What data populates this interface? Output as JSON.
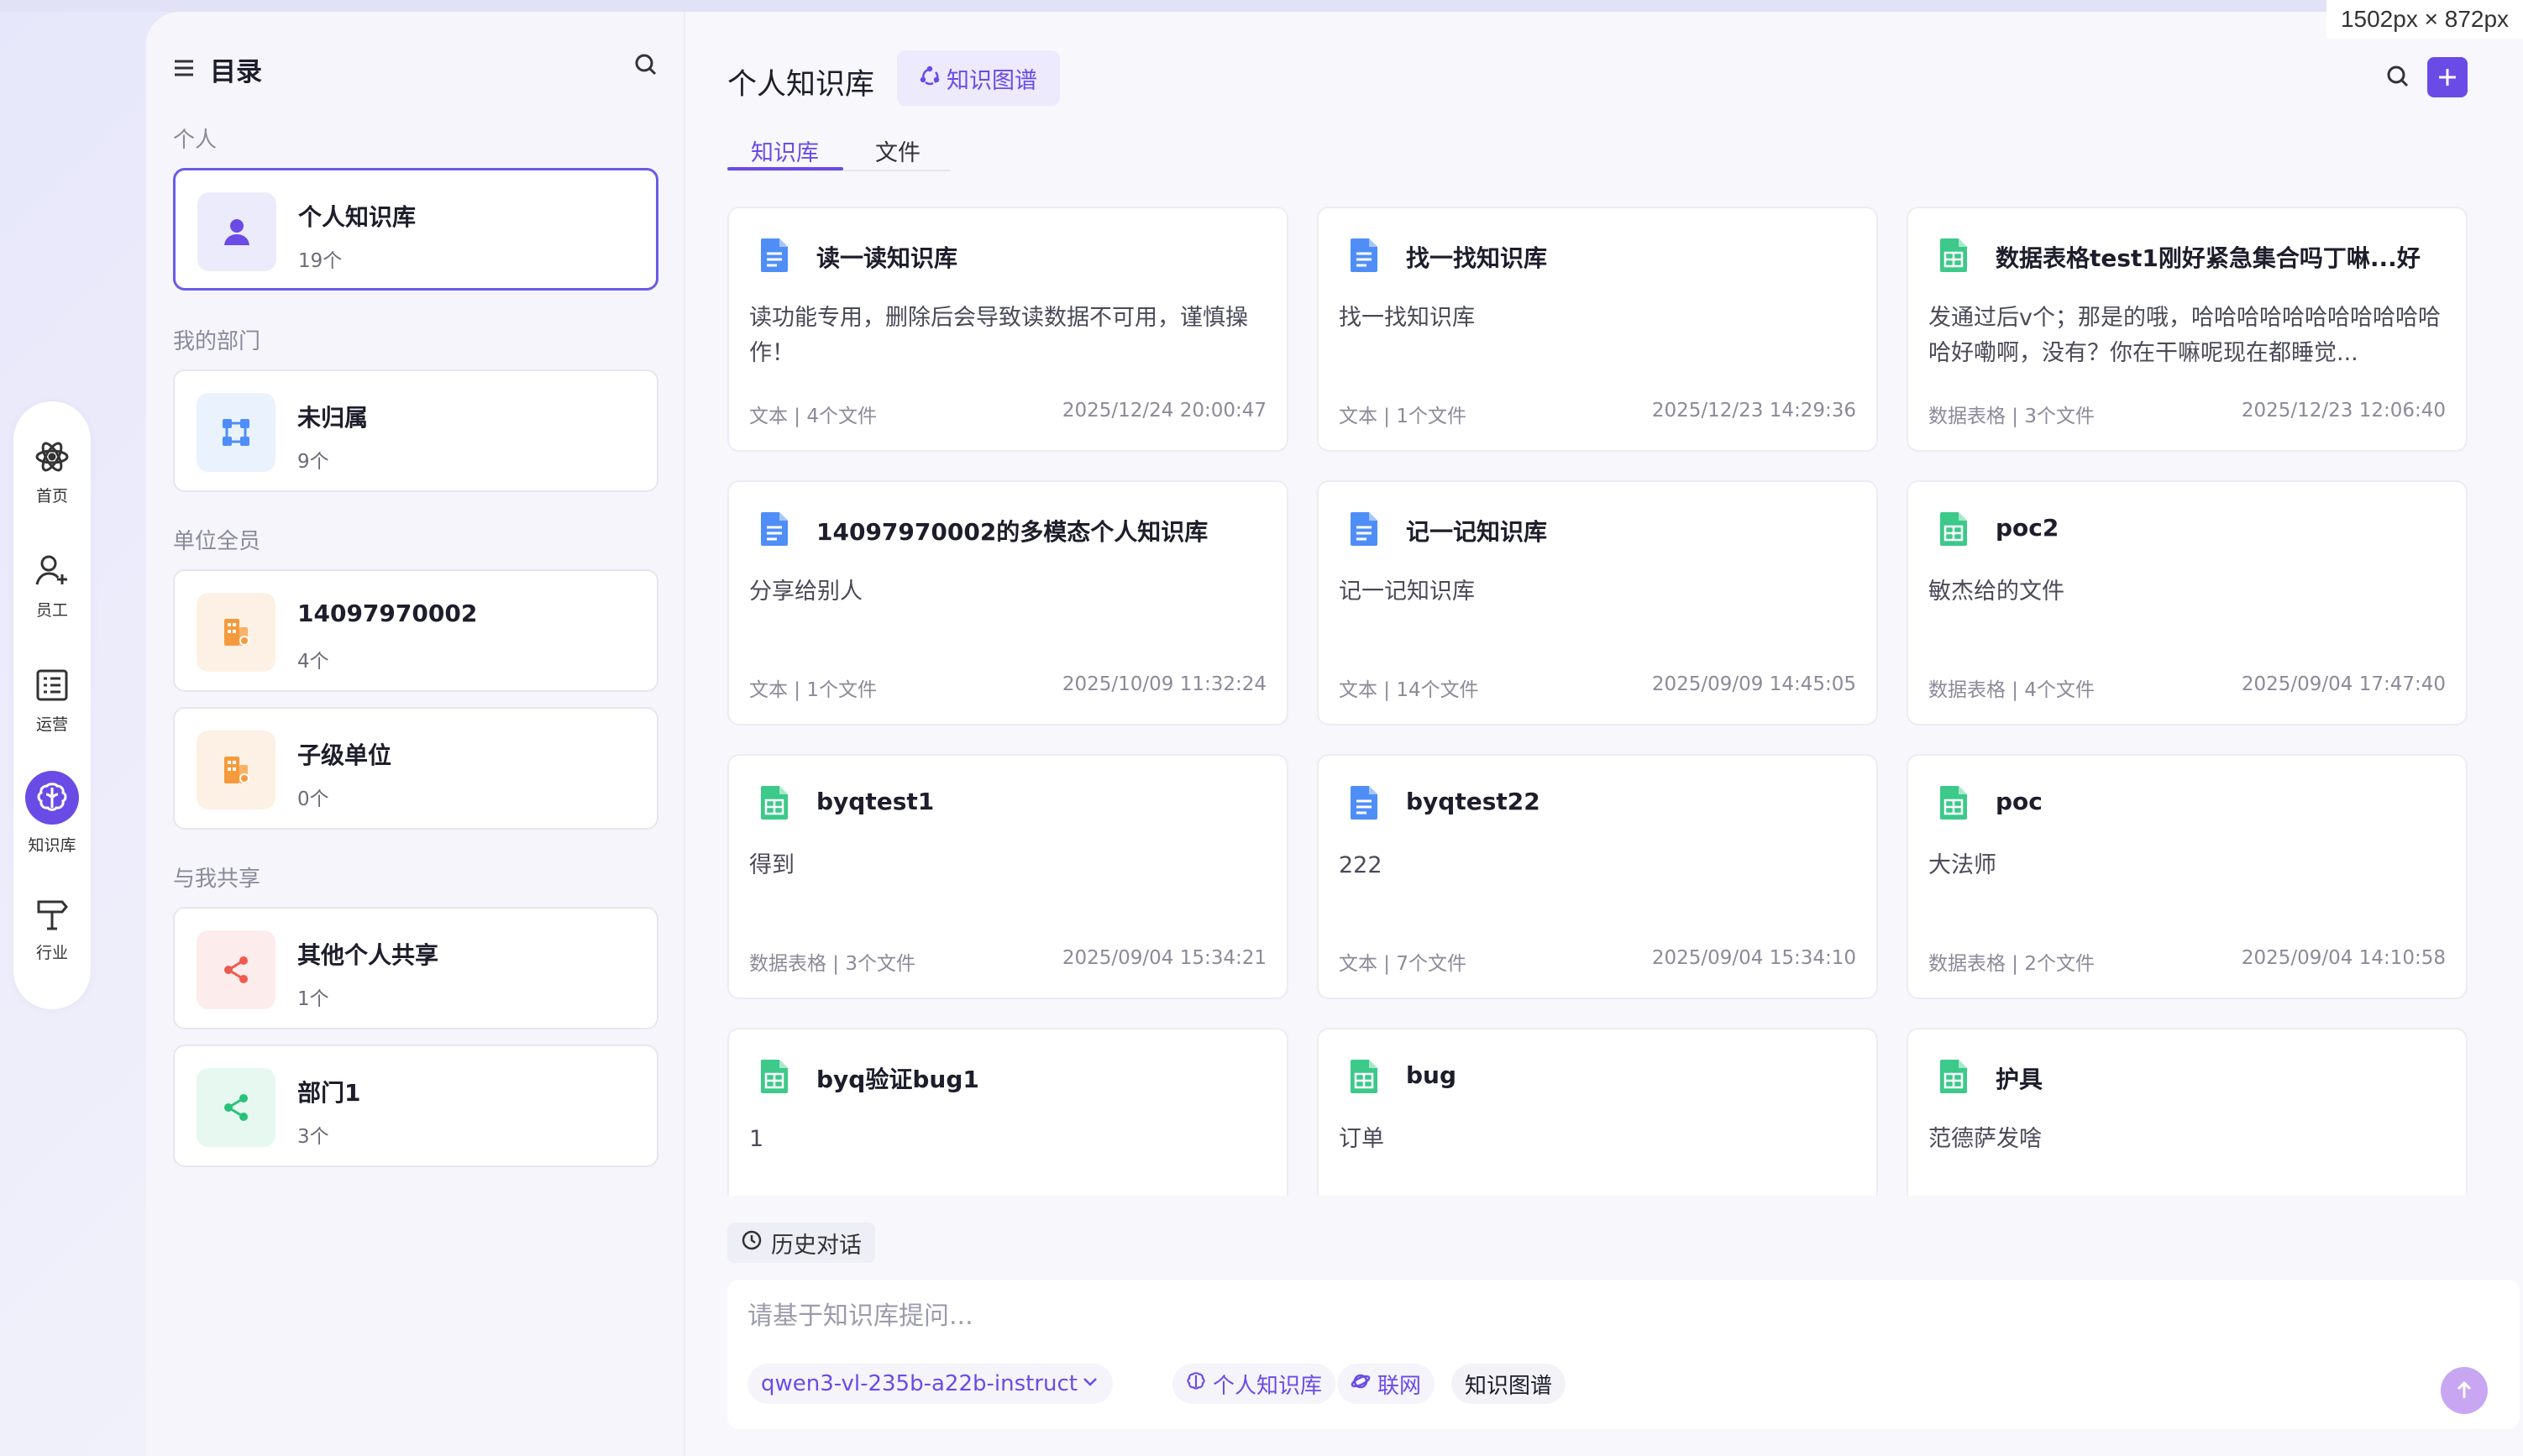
{
  "dimension_label": "1502px × 872px",
  "rail": [
    {
      "label": "首页",
      "icon": "atom-icon",
      "active": false
    },
    {
      "label": "员工",
      "icon": "user-add-icon",
      "active": false
    },
    {
      "label": "运营",
      "icon": "list-icon",
      "active": false
    },
    {
      "label": "知识库",
      "icon": "brain-icon",
      "active": true
    },
    {
      "label": "行业",
      "icon": "signpost-icon",
      "active": false
    }
  ],
  "sidebar": {
    "title": "目录",
    "sections": [
      {
        "label": "个人",
        "items": [
          {
            "name": "个人知识库",
            "count": "19个",
            "icon": "person-icon",
            "active": true
          }
        ]
      },
      {
        "label": "我的部门",
        "items": [
          {
            "name": "未归属",
            "count": "9个",
            "icon": "org-icon"
          }
        ]
      },
      {
        "label": "单位全员",
        "items": [
          {
            "name": "14097970002",
            "count": "4个",
            "icon": "building-icon"
          },
          {
            "name": "子级单位",
            "count": "0个",
            "icon": "building-icon"
          }
        ]
      },
      {
        "label": "与我共享",
        "items": [
          {
            "name": "其他个人共享",
            "count": "1个",
            "icon": "share-icon"
          },
          {
            "name": "部门1",
            "count": "3个",
            "icon": "share-icon"
          }
        ]
      }
    ]
  },
  "header": {
    "title": "个人知识库",
    "graph_button": "知识图谱",
    "tabs": [
      "知识库",
      "文件"
    ]
  },
  "cards": [
    {
      "title": "读一读知识库",
      "desc": "读功能专用，删除后会导致读数据不可用，谨慎操作！",
      "meta": "文本 | 4个文件",
      "date": "2025/12/24 20:00:47",
      "kind": "doc"
    },
    {
      "title": "找一找知识库",
      "desc": "找一找知识库",
      "meta": "文本 | 1个文件",
      "date": "2025/12/23 14:29:36",
      "kind": "doc"
    },
    {
      "title": "数据表格test1刚好紧急集合吗丁啉...好",
      "desc": "发通过后v个；那是的哦，哈哈哈哈哈哈哈哈哈哈哈哈好嘞啊，没有？你在干嘛呢现在都睡觉...",
      "meta": "数据表格 | 3个文件",
      "date": "2025/12/23 12:06:40",
      "kind": "sheet"
    },
    {
      "title": "14097970002的多模态个人知识库",
      "desc": "分享给别人",
      "meta": "文本 | 1个文件",
      "date": "2025/10/09 11:32:24",
      "kind": "doc"
    },
    {
      "title": "记一记知识库",
      "desc": "记一记知识库",
      "meta": "文本 | 14个文件",
      "date": "2025/09/09 14:45:05",
      "kind": "doc"
    },
    {
      "title": "poc2",
      "desc": "敏杰给的文件",
      "meta": "数据表格 | 4个文件",
      "date": "2025/09/04 17:47:40",
      "kind": "sheet"
    },
    {
      "title": "byqtest1",
      "desc": "得到",
      "meta": "数据表格 | 3个文件",
      "date": "2025/09/04 15:34:21",
      "kind": "sheet"
    },
    {
      "title": "byqtest22",
      "desc": "222",
      "meta": "文本 | 7个文件",
      "date": "2025/09/04 15:34:10",
      "kind": "doc"
    },
    {
      "title": "poc",
      "desc": "大法师",
      "meta": "数据表格 | 2个文件",
      "date": "2025/09/04 14:10:58",
      "kind": "sheet"
    },
    {
      "title": "byq验证bug1",
      "desc": "1",
      "meta": "",
      "date": "",
      "kind": "sheet"
    },
    {
      "title": "bug",
      "desc": "订单",
      "meta": "",
      "date": "",
      "kind": "sheet"
    },
    {
      "title": "护具",
      "desc": "范德萨发啥",
      "meta": "",
      "date": "",
      "kind": "sheet"
    }
  ],
  "chat": {
    "history_label": "历史对话",
    "placeholder": "请基于知识库提问...",
    "model": "qwen3-vl-235b-a22b-instruct",
    "kb_pill": "个人知识库",
    "net_pill": "联网",
    "graph_pill": "知识图谱"
  },
  "colors": {
    "accent": "#6a4be6",
    "doc_icon": "#4f8ef7",
    "sheet_icon": "#3cc98a",
    "building_icon": "#f59a3b",
    "share_red": "#f0594d",
    "share_green": "#28c27a"
  }
}
